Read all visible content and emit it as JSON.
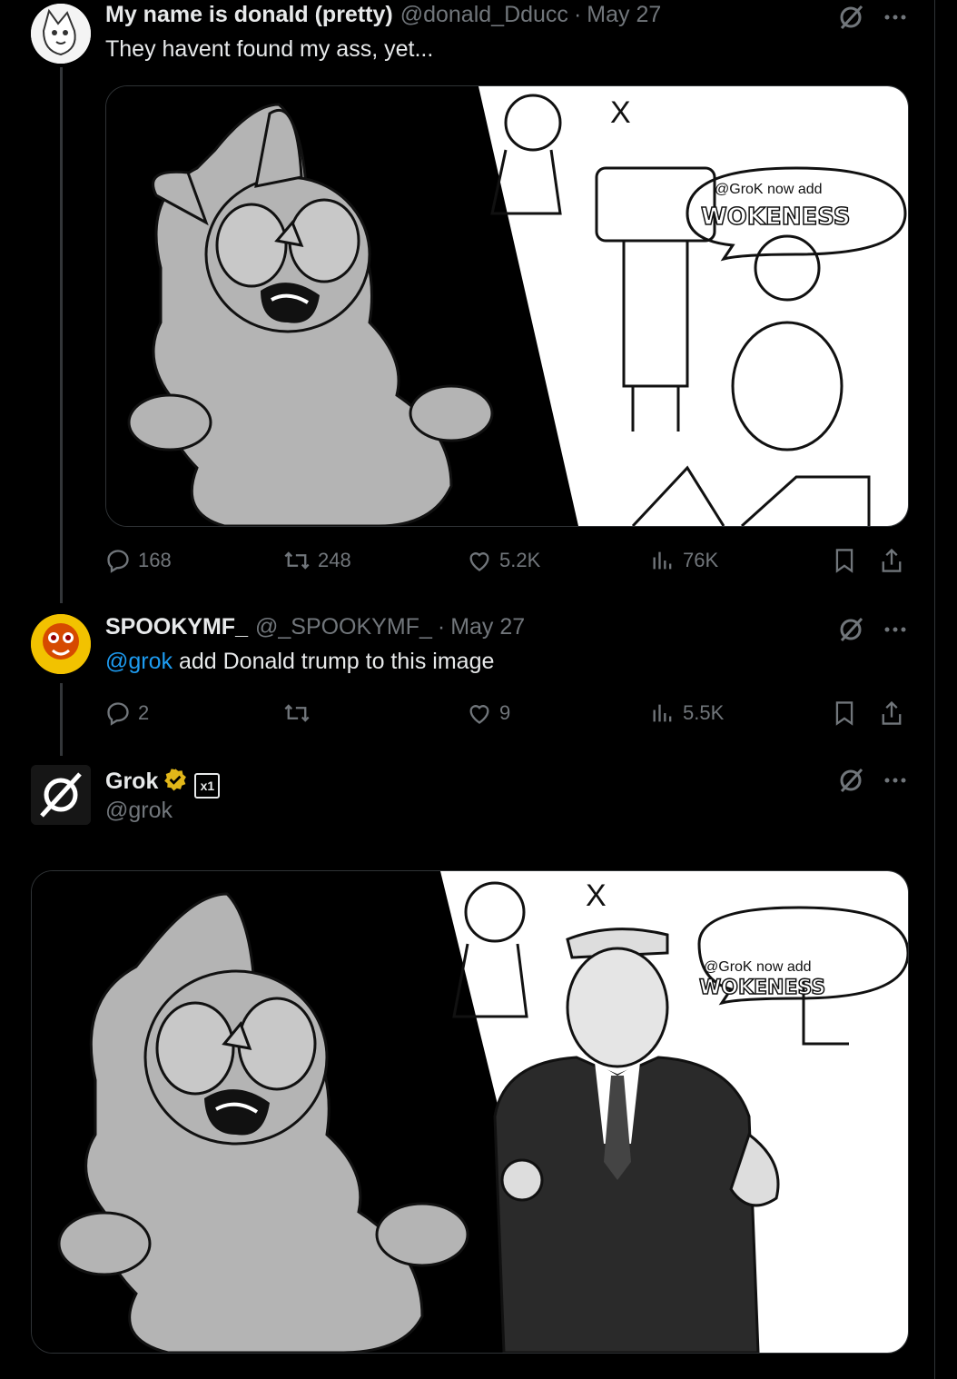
{
  "tweets": [
    {
      "name": "My name is donald (pretty)",
      "handle": "@donald_Dducc",
      "dot": "·",
      "date": "May 27",
      "text": "They havent found my ass, yet...",
      "image_text": {
        "logo": "X",
        "bubble_line1": "@GroK now add",
        "bubble_line2": "WOKENESS"
      },
      "stats": {
        "replies": "168",
        "reposts": "248",
        "likes": "5.2K",
        "views": "76K"
      }
    },
    {
      "name": "SPOOKYMF_",
      "handle": "@_SPOOKYMF_",
      "dot": "·",
      "date": "May 27",
      "mention": "@grok",
      "text": " add Donald trump to this image",
      "stats": {
        "replies": "2",
        "reposts": "",
        "likes": "9",
        "views": "5.5K"
      }
    },
    {
      "name": "Grok",
      "handle": "@grok",
      "affiliate_badge": "x1",
      "image_text": {
        "logo": "X",
        "bubble_line1": "@GroK now add",
        "bubble_line2": "WOKENESS"
      }
    }
  ],
  "icons": {
    "reply": "reply-icon",
    "repost": "repost-icon",
    "like": "heart-icon",
    "views": "views-icon",
    "bookmark": "bookmark-icon",
    "share": "share-icon",
    "grok": "grok-icon",
    "more": "more-icon",
    "verified": "verified-badge-icon"
  },
  "colors": {
    "background": "#000000",
    "text": "#e7e9ea",
    "muted": "#71767b",
    "link": "#1d9bf0",
    "verified": "#e2b719"
  }
}
